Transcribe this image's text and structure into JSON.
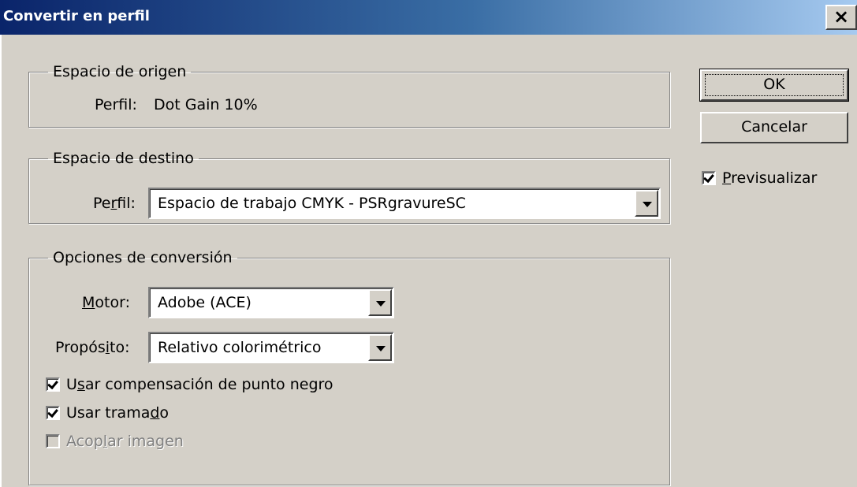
{
  "window": {
    "title": "Convertir en perfil",
    "close_glyph": "×"
  },
  "source": {
    "legend": "Espacio de origen",
    "profile_label": "Perfil:",
    "profile_value": "Dot Gain 10%"
  },
  "destination": {
    "legend": "Espacio de destino",
    "profile_label_pre": "Pe",
    "profile_label_mnemonic": "r",
    "profile_label_post": "fil:",
    "profile_value": "Espacio de trabajo CMYK - PSRgravureSC"
  },
  "conversion": {
    "legend": "Opciones de conversión",
    "engine_label_mnemonic": "M",
    "engine_label_post": "otor:",
    "engine_value": "Adobe (ACE)",
    "intent_label_pre": "Propós",
    "intent_label_mnemonic": "i",
    "intent_label_post": "to:",
    "intent_value": "Relativo colorimétrico",
    "black_point_pre": "U",
    "black_point_mnemonic": "s",
    "black_point_post": "ar compensación de punto negro",
    "black_point_checked": true,
    "dither_pre": "Usar trama",
    "dither_mnemonic": "d",
    "dither_post": "o",
    "dither_checked": true,
    "flatten_pre": "Acop",
    "flatten_mnemonic": "l",
    "flatten_post": "ar imagen",
    "flatten_checked": false,
    "flatten_enabled": false
  },
  "buttons": {
    "ok": "OK",
    "cancel": "Cancelar"
  },
  "preview": {
    "label_mnemonic": "P",
    "label_post": "revisualizar",
    "checked": true
  },
  "icons": {
    "close": "close-icon",
    "dropdown": "chevron-down-icon",
    "check": "checkmark-icon"
  }
}
